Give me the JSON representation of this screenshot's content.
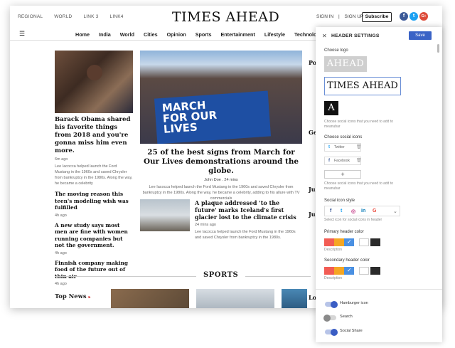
{
  "site": {
    "top_links": [
      "REGIONAL",
      "WORLD",
      "LINK 3",
      "LINK4"
    ],
    "logo": "TIMES AHEAD",
    "sign_in": "SIGN IN",
    "sign_up": "SIGN UP",
    "separator": "|",
    "subscribe": "Subscribe",
    "social": [
      {
        "icon": "facebook-icon",
        "glyph": "f",
        "color": "#3b5998"
      },
      {
        "icon": "twitter-icon",
        "glyph": "t",
        "color": "#1da1f2"
      },
      {
        "icon": "google-plus-icon",
        "glyph": "G+",
        "color": "#dd4b39"
      }
    ],
    "hamburger": "☰",
    "nav": [
      "Home",
      "India",
      "World",
      "Cities",
      "Opinion",
      "Sports",
      "Entertainment",
      "Lifestyle",
      "Technolog"
    ]
  },
  "left_column": {
    "lead_title": "Barack Obama shared his favorite things from 2018 and you're gonna miss him even more.",
    "lead_meta": "6m ago",
    "lead_excerpt": "Lee Iacocca helped launch the Ford Mustang in the 1960s and saved Chrysler from bankruptcy in the 1980s. Along the way, he became a celebrity",
    "stories": [
      {
        "title": "The moving reason this teen's modeling wish was fulfilled",
        "meta": "4h ago"
      },
      {
        "title": "A new study says most men are fine with women running companies but not the government.",
        "meta": "4h ago"
      },
      {
        "title": "Finnish company making food of the future out of thin air",
        "meta": "4h ago"
      }
    ]
  },
  "center": {
    "image_sign_text": [
      "MARCH",
      "FOR OUR",
      "LIVES"
    ],
    "title": "25 of the best signs from March for Our Lives demonstrations around the globe.",
    "meta": "John Doe . 24 mins",
    "excerpt": "Lee Iacocca helped launch the Ford Mustang in the 1960s and saved Chrysler from bankruptcy in the 1980s. Along the way, he became a celebrity, adding to his allure with TV commercials",
    "story2_title": "A plaque addressed 'to the future' marks Iceland's first glacier lost to the climate crisis",
    "story2_meta": "24 mins ago",
    "story2_excerpt": "Lee Iacocca helped launch the Ford Mustang in the 1960s and saved Chrysler from bankruptcy in the 1980s."
  },
  "right_partial": [
    "Po",
    "Ge",
    "Jus",
    "Jus",
    "Lon"
  ],
  "sports_heading": "SPORTS",
  "top_news": "Top News",
  "top_news_arrow": "▸",
  "panel": {
    "close": "✕",
    "title": "HEADER SETTINGS",
    "save": "Save",
    "choose_logo": "Choose logo",
    "logo_options": [
      "AHEAD",
      "TIMES AHEAD",
      "A"
    ],
    "logo_desc": "Choose social icons that you need to add to meanubar",
    "choose_social": "Choose social icons",
    "social_rows": [
      {
        "name": "Twitter",
        "icon": "twitter-icon",
        "glyph": "t",
        "color": "#1da1f2"
      },
      {
        "name": "Facebook",
        "icon": "facebook-icon",
        "glyph": "f",
        "color": "#3b5998"
      }
    ],
    "trash_glyph": "🗑",
    "add_glyph": "+",
    "social_desc": "Choose social icons that you need to add to meanubar",
    "icon_style_label": "Social icon style",
    "icon_style_icons": [
      {
        "icon": "facebook-icon",
        "glyph": "f",
        "color": "#3b5998"
      },
      {
        "icon": "twitter-icon",
        "glyph": "t",
        "color": "#1da1f2"
      },
      {
        "icon": "instagram-icon",
        "glyph": "◎",
        "color": "#c13584"
      },
      {
        "icon": "linkedin-icon",
        "glyph": "in",
        "color": "#0077b5"
      },
      {
        "icon": "google-icon",
        "glyph": "G",
        "color": "#ea4335"
      }
    ],
    "icon_style_chevron": "⌄",
    "icon_style_desc": "Select icon for social icons in header",
    "primary_color_label": "Primary header color",
    "primary_swatches": [
      "#f25c54",
      "#f5a623",
      "#4a90e2",
      "#ffffff",
      "#2b2b2b"
    ],
    "primary_desc": "Description",
    "secondary_color_label": "Secondary header color",
    "secondary_swatches": [
      "#f25c54",
      "#f5a623",
      "#4a90e2",
      "#ffffff",
      "#2b2b2b"
    ],
    "secondary_desc": "Description",
    "check_glyph": "✓",
    "toggles": [
      {
        "label": "Hamburger icon",
        "on": true
      },
      {
        "label": "Search",
        "on": false
      },
      {
        "label": "Social Share",
        "on": true
      }
    ]
  }
}
